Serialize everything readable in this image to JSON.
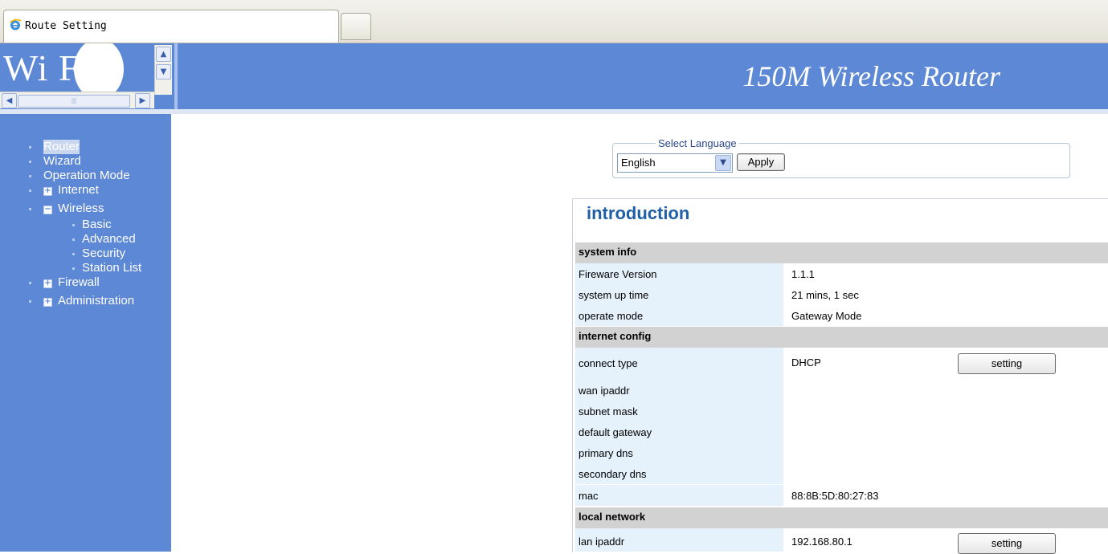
{
  "browser": {
    "tab_title": "Route Setting"
  },
  "header": {
    "logo_text": "Wi Fi",
    "title": "150M Wireless Router"
  },
  "sidebar": {
    "items": [
      {
        "label": "Router",
        "selected": true
      },
      {
        "label": "Wizard"
      },
      {
        "label": "Operation Mode"
      },
      {
        "label": "Internet",
        "expander": "+"
      },
      {
        "label": "Wireless",
        "expander": "-"
      },
      {
        "label": "Basic"
      },
      {
        "label": "Advanced"
      },
      {
        "label": "Security"
      },
      {
        "label": "Station List"
      },
      {
        "label": "Firewall",
        "expander": "+"
      },
      {
        "label": "Administration",
        "expander": "+"
      }
    ]
  },
  "language": {
    "legend": "Select Language",
    "selected": "English",
    "apply_label": "Apply"
  },
  "intro": {
    "title": "introduction",
    "system_info": {
      "heading": "system info",
      "rows": [
        {
          "label": "Fireware Version",
          "value": "1.1.1"
        },
        {
          "label": "system up time",
          "value": "21 mins, 1 sec"
        },
        {
          "label": "operate mode",
          "value": "Gateway Mode"
        }
      ]
    },
    "internet_config": {
      "heading": "internet config",
      "rows": [
        {
          "label": "connect type",
          "value": "DHCP"
        },
        {
          "label": "wan ipaddr",
          "value": ""
        },
        {
          "label": "subnet mask",
          "value": ""
        },
        {
          "label": "default gateway",
          "value": ""
        },
        {
          "label": "primary dns",
          "value": ""
        },
        {
          "label": "secondary dns",
          "value": ""
        },
        {
          "label": "mac",
          "value": "88:8B:5D:80:27:83"
        }
      ],
      "setting_label": "setting"
    },
    "local_network": {
      "heading": "local network",
      "rows": [
        {
          "label": "lan ipaddr",
          "value": "192.168.80.1"
        }
      ],
      "setting_label": "setting"
    }
  },
  "colors": {
    "sidebar_bg": "#5d88d6",
    "header_bg": "#5d88d6",
    "intro_title": "#1f5fa8",
    "label_cell_bg": "#e5f1fb",
    "section_bg": "#d2d2d2"
  }
}
